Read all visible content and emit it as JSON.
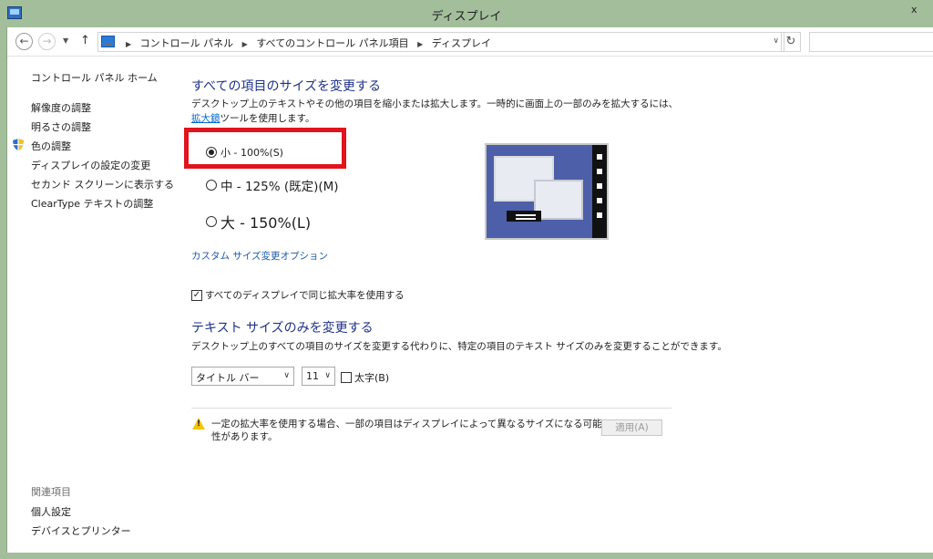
{
  "window": {
    "title": "ディスプレイ",
    "close_glyph": "x"
  },
  "address": {
    "crumbs": [
      "コントロール パネル",
      "すべてのコントロール パネル項目",
      "ディスプレイ"
    ]
  },
  "sidebar": {
    "home": "コントロール パネル ホーム",
    "items": [
      "解像度の調整",
      "明るさの調整",
      "色の調整",
      "ディスプレイの設定の変更",
      "セカンド スクリーンに表示する",
      "ClearType テキストの調整"
    ],
    "related_heading": "関連項目",
    "related": [
      "個人設定",
      "デバイスとプリンター"
    ]
  },
  "size_section": {
    "heading": "すべての項目のサイズを変更する",
    "desc_before": "デスクトップ上のテキストやその他の項目を縮小または拡大します。一時的に画面上の一部のみを拡大するには、",
    "desc_link": "拡大鏡",
    "desc_after": "ツールを使用します。",
    "options": [
      {
        "label": "小 - 100%(S)",
        "selected": true
      },
      {
        "label": "中 - 125% (既定)(M)",
        "selected": false
      },
      {
        "label": "大 - 150%(L)",
        "selected": false
      }
    ],
    "custom_link": "カスタム サイズ変更オプション",
    "same_scale_label": "すべてのディスプレイで同じ拡大率を使用する",
    "same_scale_checked": true
  },
  "text_section": {
    "heading": "テキスト サイズのみを変更する",
    "desc": "デスクトップ上のすべての項目のサイズを変更する代わりに、特定の項目のテキスト サイズのみを変更することができます。",
    "item_select": "タイトル バー",
    "size_select": "11",
    "bold_label": "太字(B)",
    "bold_checked": false
  },
  "footer": {
    "warning": "一定の拡大率を使用する場合、一部の項目はディスプレイによって異なるサイズになる可能性があります。",
    "apply_label": "適用(A)"
  }
}
